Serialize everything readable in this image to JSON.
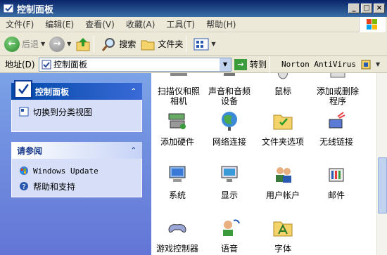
{
  "window": {
    "title": "控制面板",
    "controls": [
      "_",
      "□",
      "×"
    ]
  },
  "menu": [
    "文件(F)",
    "编辑(E)",
    "查看(V)",
    "收藏(A)",
    "工具(T)",
    "帮助(H)"
  ],
  "toolbar": {
    "back": "后退",
    "search": "搜索",
    "folders": "文件夹"
  },
  "address": {
    "label": "地址(D)",
    "value": "控制面板",
    "go": "转到",
    "norton": "Norton AntiVirus"
  },
  "sidebar": {
    "panel1": {
      "title": "控制面板",
      "task": "切换到分类视图"
    },
    "panel2": {
      "title": "请参阅",
      "links": [
        "Windows Update",
        "帮助和支持"
      ]
    }
  },
  "items": {
    "row0": [
      "扫描仪和照相机",
      "声音和音频设备",
      "鼠标",
      "添加或删除程序"
    ],
    "row1": [
      "添加硬件",
      "网络连接",
      "文件夹选项",
      "无线链接"
    ],
    "row2": [
      "系统",
      "显示",
      "用户帐户",
      "邮件"
    ],
    "row3": [
      "游戏控制器",
      "语音",
      "字体"
    ]
  },
  "colors": {
    "titlebar": "#0a246a",
    "taskpane": "#6375d6",
    "panel_head": "#0048a8"
  }
}
